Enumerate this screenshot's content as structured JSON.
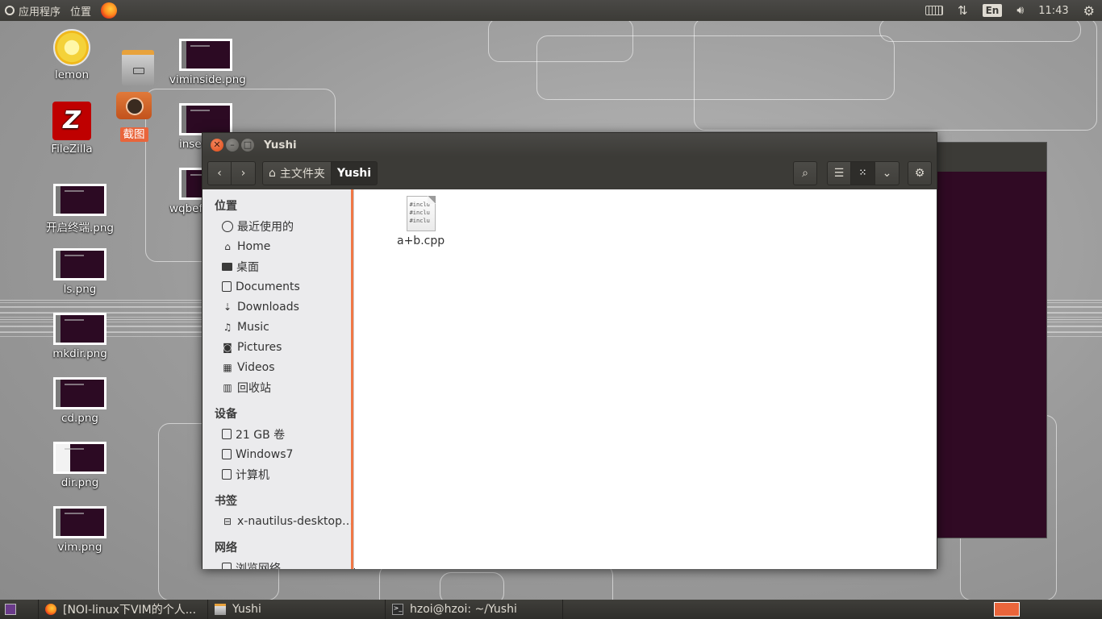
{
  "top_panel": {
    "applications": "应用程序",
    "places": "位置",
    "lang": "En",
    "time": "11:43"
  },
  "desktop": {
    "icons": [
      {
        "label": "lemon",
        "icon": "lemon-icon"
      },
      {
        "label": "FileZilla",
        "icon": "filezilla-icon"
      },
      {
        "label": "viminside.png",
        "icon": "image-thumbnail"
      },
      {
        "label": "inse",
        "icon": "image-thumbnail"
      },
      {
        "label": "wqbef",
        "icon": "image-thumbnail"
      },
      {
        "label": "截图",
        "icon": "screenshot-camera-icon"
      },
      {
        "label": "开启终端.png",
        "icon": "image-thumbnail"
      },
      {
        "label": "ls.png",
        "icon": "image-thumbnail"
      },
      {
        "label": "mkdir.png",
        "icon": "image-thumbnail"
      },
      {
        "label": "cd.png",
        "icon": "image-thumbnail"
      },
      {
        "label": "dir.png",
        "icon": "image-thumbnail"
      },
      {
        "label": "vim.png",
        "icon": "image-thumbnail"
      }
    ]
  },
  "window": {
    "title": "Yushi",
    "breadcrumb_home": "主文件夹",
    "breadcrumb_current": "Yushi"
  },
  "sidebar": {
    "sections": [
      {
        "title": "位置",
        "items": [
          {
            "label": "最近使用的",
            "icon": "recent-clock-icon"
          },
          {
            "label": "Home",
            "icon": "home-icon"
          },
          {
            "label": "桌面",
            "icon": "desktop-folder-icon"
          },
          {
            "label": "Documents",
            "icon": "document-icon"
          },
          {
            "label": "Downloads",
            "icon": "download-icon"
          },
          {
            "label": "Music",
            "icon": "music-icon"
          },
          {
            "label": "Pictures",
            "icon": "camera-icon"
          },
          {
            "label": "Videos",
            "icon": "film-icon"
          },
          {
            "label": "回收站",
            "icon": "trash-icon"
          }
        ]
      },
      {
        "title": "设备",
        "items": [
          {
            "label": "21 GB 卷",
            "icon": "drive-icon"
          },
          {
            "label": "Windows7",
            "icon": "drive-icon"
          },
          {
            "label": "计算机",
            "icon": "drive-icon"
          }
        ]
      },
      {
        "title": "书签",
        "items": [
          {
            "label": "x-nautilus-desktop…",
            "icon": "network-bookmark-icon"
          }
        ]
      },
      {
        "title": "网络",
        "items": [
          {
            "label": "浏览网络",
            "icon": "network-icon"
          }
        ]
      }
    ]
  },
  "files": [
    {
      "name": "a+b.cpp",
      "preview": [
        "#inclu",
        "#inclu",
        "#inclu"
      ]
    }
  ],
  "taskbar": {
    "tasks": [
      {
        "label": "[NOI-linux下VIM的个人...",
        "icon": "firefox-icon"
      },
      {
        "label": "Yushi",
        "icon": "file-cabinet-icon"
      },
      {
        "label": "hzoi@hzoi: ~/Yushi",
        "icon": "terminal-icon"
      }
    ]
  },
  "colors": {
    "panel": "#3c3b37",
    "accent": "#f07746",
    "terminal_bg": "#300a24",
    "sidebar_bg": "#ebebed"
  }
}
